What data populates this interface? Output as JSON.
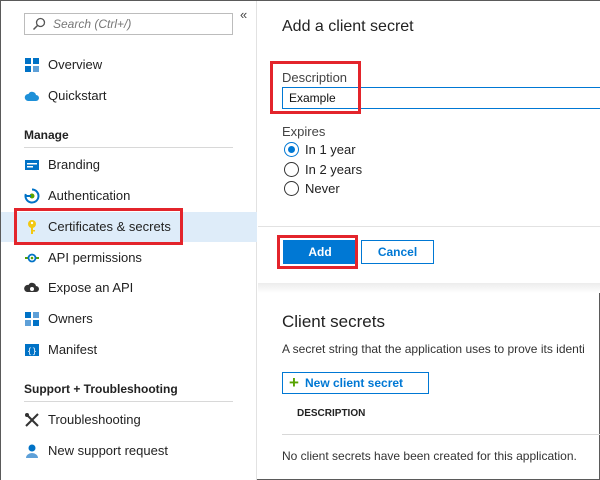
{
  "search": {
    "placeholder": "Search (Ctrl+/)"
  },
  "sidebar": {
    "collapse": "«",
    "top_items": [
      {
        "label": "Overview",
        "icon": "overview-grid-icon"
      },
      {
        "label": "Quickstart",
        "icon": "cloud-icon"
      }
    ],
    "manage_header": "Manage",
    "manage_items": [
      {
        "label": "Branding",
        "icon": "branding-card-icon"
      },
      {
        "label": "Authentication",
        "icon": "authentication-icon"
      },
      {
        "label": "Certificates & secrets",
        "icon": "key-icon",
        "selected": true
      },
      {
        "label": "API permissions",
        "icon": "api-permissions-icon"
      },
      {
        "label": "Expose an API",
        "icon": "cloud-gear-icon"
      },
      {
        "label": "Owners",
        "icon": "owners-grid-icon"
      },
      {
        "label": "Manifest",
        "icon": "manifest-icon"
      }
    ],
    "support_header": "Support + Troubleshooting",
    "support_items": [
      {
        "label": "Troubleshooting",
        "icon": "tools-icon"
      },
      {
        "label": "New support request",
        "icon": "support-person-icon"
      }
    ]
  },
  "panel": {
    "title": "Add a client secret",
    "description_label": "Description",
    "description_value": "Example",
    "expires_label": "Expires",
    "expires_options": [
      {
        "label": "In 1 year",
        "checked": true
      },
      {
        "label": "In 2 years",
        "checked": false
      },
      {
        "label": "Never",
        "checked": false
      }
    ],
    "add_label": "Add",
    "cancel_label": "Cancel"
  },
  "client_secrets": {
    "title": "Client secrets",
    "description": "A secret string that the application uses to prove its identi",
    "new_button": "New client secret",
    "column_header": "DESCRIPTION",
    "empty_message": "No client secrets have been created for this application."
  },
  "colors": {
    "accent": "#0078d4",
    "highlight": "#e3242b",
    "selected_bg": "#deecf9"
  }
}
